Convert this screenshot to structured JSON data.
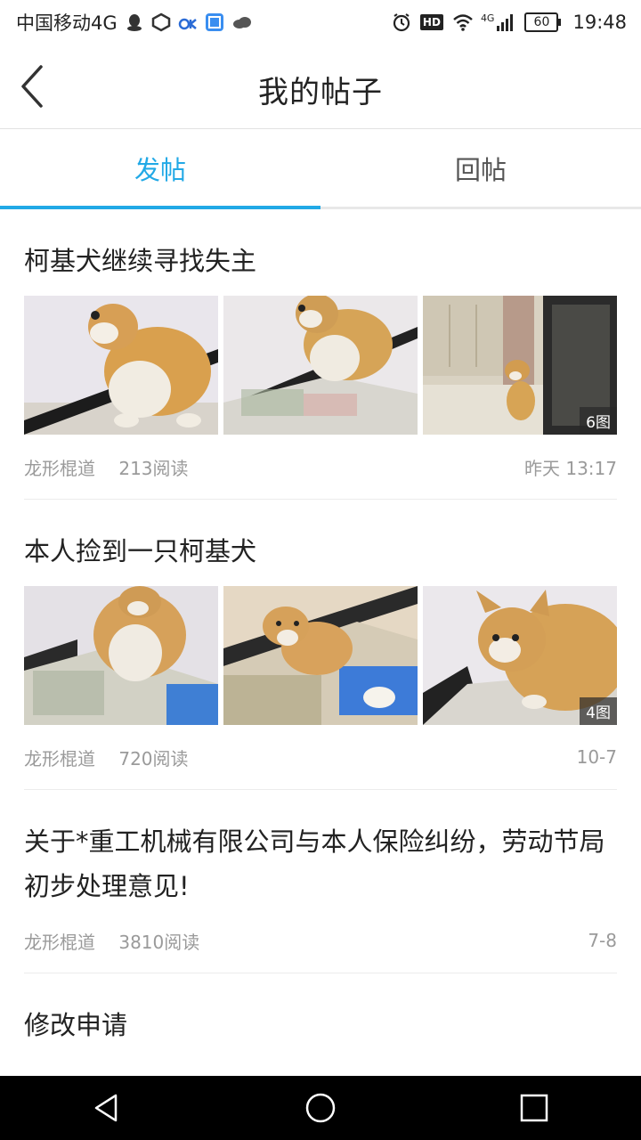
{
  "status_bar": {
    "carrier": "中国移动4G",
    "network_label": "4G",
    "hd_label": "HD",
    "battery": "60",
    "time": "19:48"
  },
  "header": {
    "title": "我的帖子"
  },
  "tabs": [
    {
      "label": "发帖",
      "active": true
    },
    {
      "label": "回帖",
      "active": false
    }
  ],
  "posts": [
    {
      "title": "柯基犬继续寻找失主",
      "author": "龙形棍道",
      "reads": "213阅读",
      "time": "昨天 13:17",
      "image_count": "6图"
    },
    {
      "title": "本人捡到一只柯基犬",
      "author": "龙形棍道",
      "reads": "720阅读",
      "time": "10-7",
      "image_count": "4图"
    },
    {
      "title": "关于*重工机械有限公司与本人保险纠纷，劳动节局初步处理意见!",
      "author": "龙形棍道",
      "reads": "3810阅读",
      "time": "7-8"
    },
    {
      "title": "修改申请"
    }
  ],
  "colors": {
    "accent": "#22a9e6",
    "meta_text": "#9a9a9a"
  }
}
